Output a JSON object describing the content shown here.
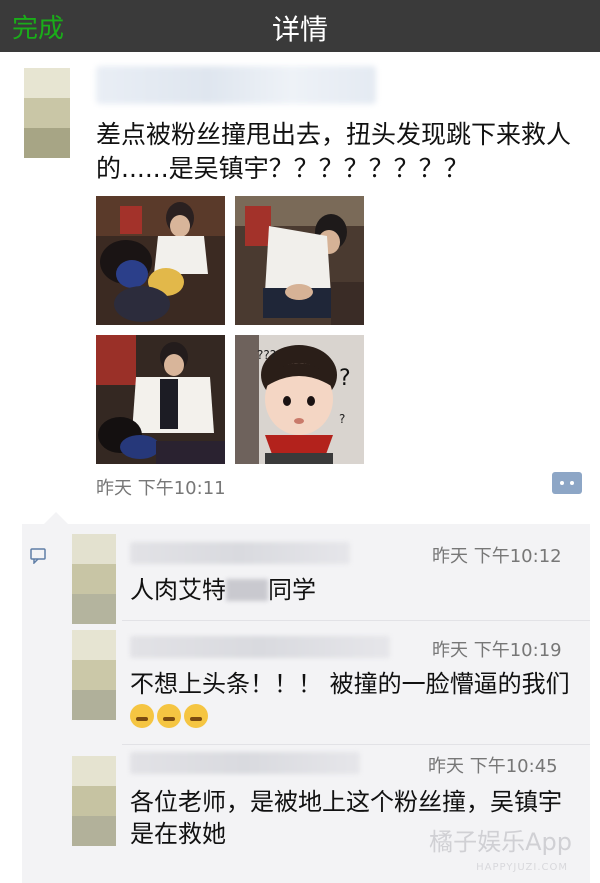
{
  "nav": {
    "back_label": "完成",
    "title": "详情"
  },
  "post": {
    "text": "差点被粉丝撞甩出去，扭头发现跳下来救人的......是吴镇宇？？？？？？？？",
    "time": "昨天 下午10:11",
    "images": [
      "photo-1",
      "photo-2",
      "photo-3",
      "photo-4"
    ]
  },
  "comments": [
    {
      "time": "昨天 下午10:12",
      "text_before": "人肉艾特",
      "text_after": "同学"
    },
    {
      "time": "昨天 下午10:19",
      "text": "不想上头条！！！ 被撞的一脸懵逼的我们"
    },
    {
      "time": "昨天 下午10:45",
      "text": "各位老师，是被地上这个粉丝撞，吴镇宇是在救她"
    }
  ],
  "watermark": {
    "main": "橘子娱乐App",
    "sub": "HAPPYJUZI.COM"
  },
  "colors": {
    "nav_bg": "#3a3a3a",
    "back_green": "#1aad19",
    "comment_bg": "#f3f3f5"
  }
}
